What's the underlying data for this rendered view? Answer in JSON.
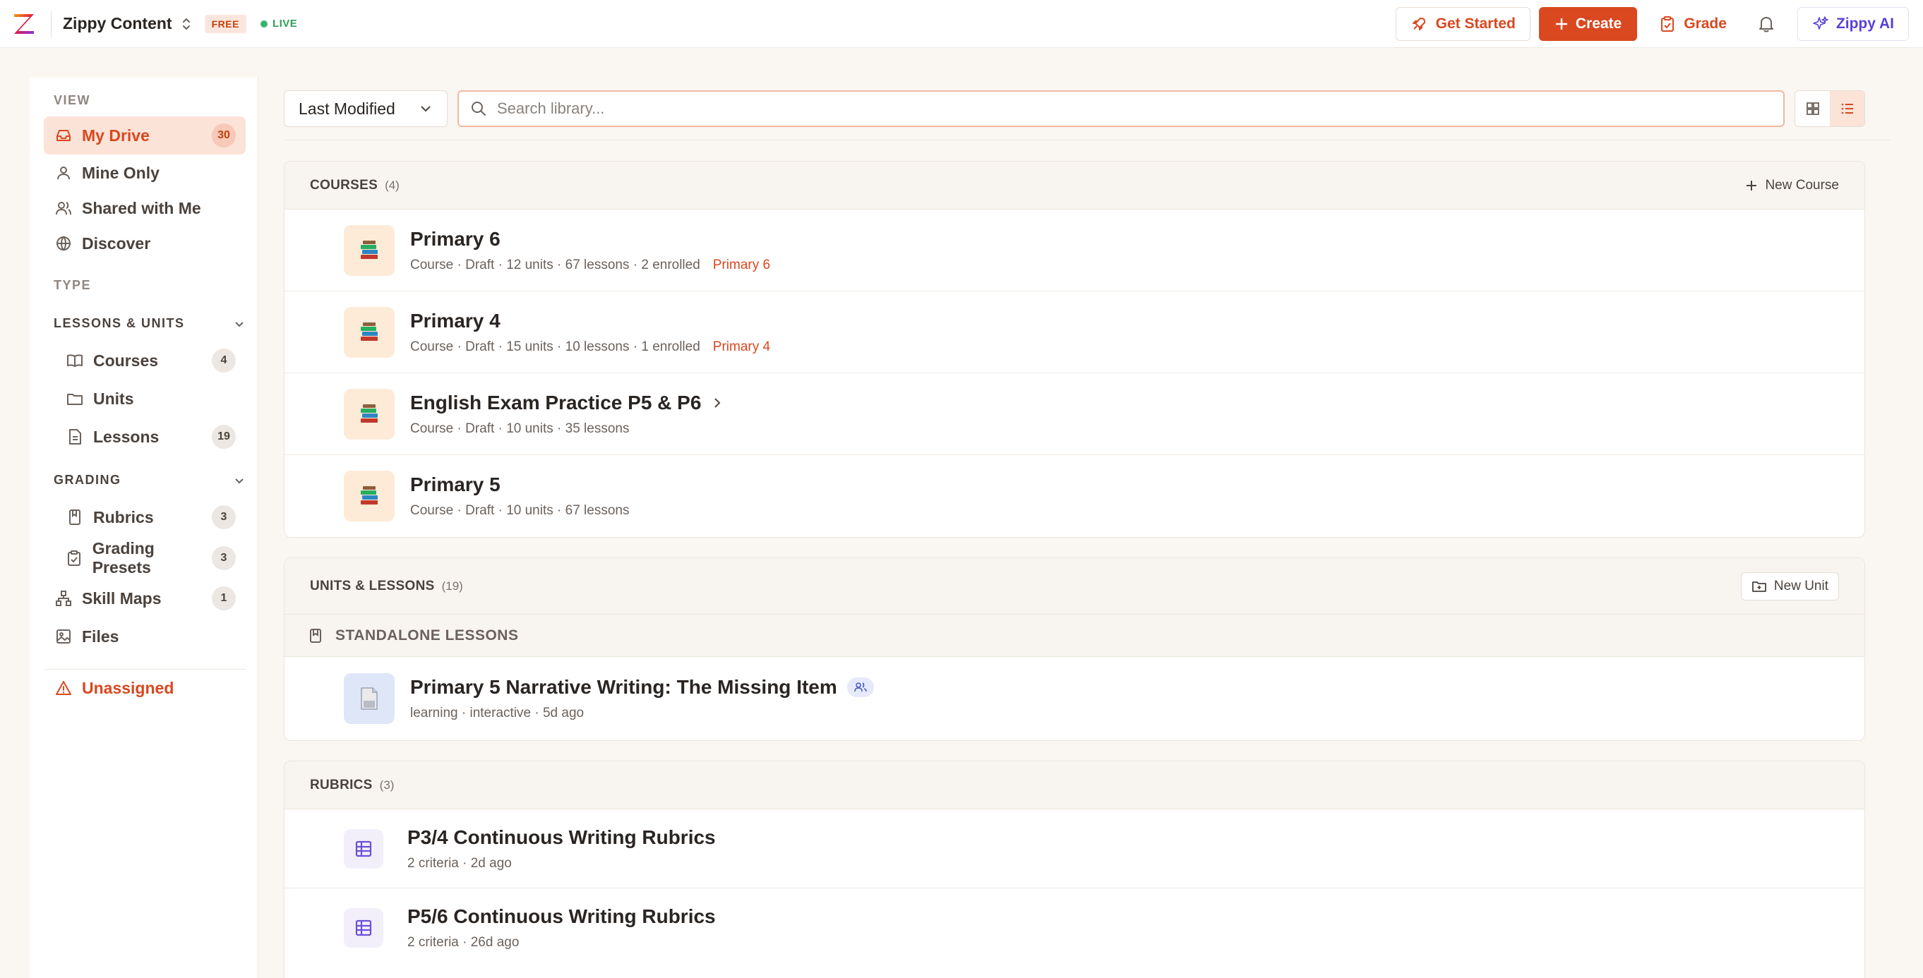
{
  "app": {
    "name": "Zippy Content",
    "plan_badge": "FREE",
    "status": "LIVE"
  },
  "topbar": {
    "get_started": "Get Started",
    "create": "Create",
    "grade": "Grade",
    "zippy_ai": "Zippy AI"
  },
  "colors": {
    "accent": "#d9481f",
    "ai_purple": "#5b3fd6",
    "live_green": "#38b36a"
  },
  "sidebar": {
    "view_label": "VIEW",
    "type_label": "TYPE",
    "my_drive": {
      "label": "My Drive",
      "count": "30"
    },
    "mine_only": "Mine Only",
    "shared_with_me": "Shared with Me",
    "discover": "Discover",
    "lessons_units_group": "LESSONS & UNITS",
    "courses": {
      "label": "Courses",
      "count": "4"
    },
    "units": "Units",
    "lessons": {
      "label": "Lessons",
      "count": "19"
    },
    "grading_group": "GRADING",
    "rubrics": {
      "label": "Rubrics",
      "count": "3"
    },
    "grading_presets": {
      "label": "Grading Presets",
      "count": "3"
    },
    "skill_maps": {
      "label": "Skill Maps",
      "count": "1"
    },
    "files": "Files",
    "unassigned": "Unassigned"
  },
  "toolbar": {
    "sort_value": "Last Modified",
    "search_placeholder": "Search library..."
  },
  "courses": {
    "title": "COURSES",
    "count": "(4)",
    "action": "New Course",
    "items": [
      {
        "title": "Primary 6",
        "meta": "Course · Draft · 12 units · 67 lessons · 2 enrolled",
        "tag": "Primary 6"
      },
      {
        "title": "Primary 4",
        "meta": "Course · Draft · 15 units · 10 lessons · 1 enrolled",
        "tag": "Primary 4"
      },
      {
        "title": "English Exam Practice P5 & P6",
        "meta": "Course · Draft · 10 units · 35 lessons",
        "tag": ""
      },
      {
        "title": "Primary 5",
        "meta": "Course · Draft · 10 units · 67 lessons",
        "tag": ""
      }
    ]
  },
  "units_lessons": {
    "title": "UNITS & LESSONS",
    "count": "(19)",
    "action": "New Unit",
    "standalone_label": "STANDALONE LESSONS",
    "items": [
      {
        "title": "Primary 5 Narrative Writing: The Missing Item",
        "meta": "learning · interactive · 5d ago"
      }
    ]
  },
  "rubrics": {
    "title": "RUBRICS",
    "count": "(3)",
    "items": [
      {
        "title": "P3/4 Continuous Writing Rubrics",
        "meta": "2 criteria · 2d ago"
      },
      {
        "title": "P5/6 Continuous Writing Rubrics",
        "meta": "2 criteria · 26d ago"
      }
    ]
  }
}
